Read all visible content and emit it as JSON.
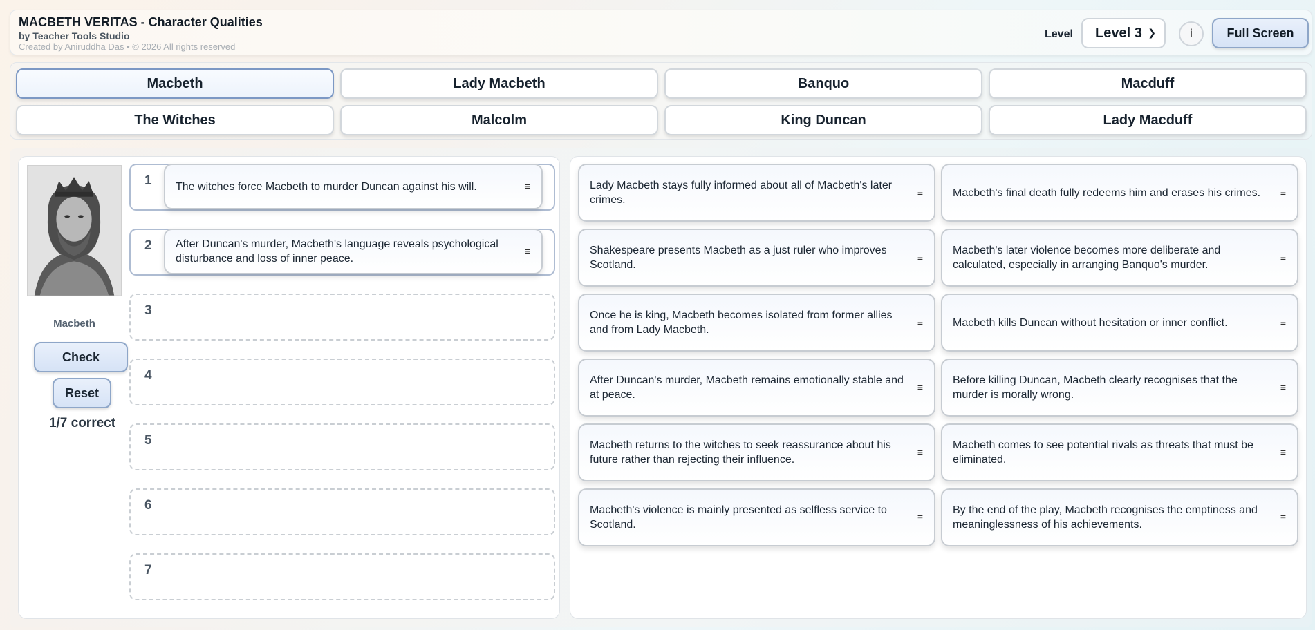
{
  "header": {
    "title": "MACBETH VERITAS - Character Qualities",
    "byline": "by Teacher Tools Studio",
    "credit": "Created by Aniruddha Das • © 2026 All rights reserved",
    "level_label": "Level",
    "level_value": "Level 3",
    "info_label": "i",
    "fullscreen_label": "Full Screen"
  },
  "characters": [
    {
      "label": "Macbeth",
      "active": true
    },
    {
      "label": "Lady Macbeth"
    },
    {
      "label": "Banquo"
    },
    {
      "label": "Macduff"
    },
    {
      "label": "The Witches"
    },
    {
      "label": "Malcolm"
    },
    {
      "label": "King Duncan"
    },
    {
      "label": "Lady Macduff"
    }
  ],
  "left": {
    "character_name": "Macbeth",
    "check_label": "Check",
    "reset_label": "Reset",
    "score": "1/7 correct",
    "slots": [
      {
        "num": "1",
        "text": "The witches force Macbeth to murder Duncan against his will."
      },
      {
        "num": "2",
        "text": "After Duncan's murder, Macbeth's language reveals psychological disturbance and loss of inner peace."
      },
      {
        "num": "3",
        "text": ""
      },
      {
        "num": "4",
        "text": ""
      },
      {
        "num": "5",
        "text": ""
      },
      {
        "num": "6",
        "text": ""
      },
      {
        "num": "7",
        "text": ""
      }
    ]
  },
  "bank": [
    "Lady Macbeth stays fully informed about all of Macbeth's later crimes.",
    "Macbeth's final death fully redeems him and erases his crimes.",
    "Shakespeare presents Macbeth as a just ruler who improves Scotland.",
    "Macbeth's later violence becomes more deliberate and calculated, especially in arranging Banquo's murder.",
    "Once he is king, Macbeth becomes isolated from former allies and from Lady Macbeth.",
    "Macbeth kills Duncan without hesitation or inner conflict.",
    "After Duncan's murder, Macbeth remains emotionally stable and at peace.",
    "Before killing Duncan, Macbeth clearly recognises that the murder is morally wrong.",
    "Macbeth returns to the witches to seek reassurance about his future rather than rejecting their influence.",
    "Macbeth comes to see potential rivals as threats that must be eliminated.",
    "Macbeth's violence is mainly presented as selfless service to Scotland.",
    "By the end of the play, Macbeth recognises the emptiness and meaninglessness of his achievements."
  ],
  "grip_glyph": "≡"
}
